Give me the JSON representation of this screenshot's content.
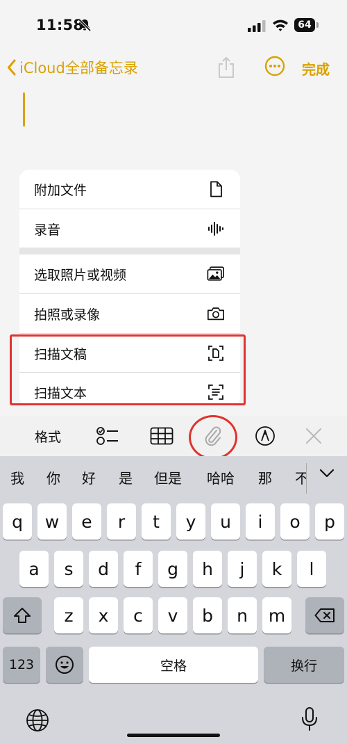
{
  "status_bar": {
    "time": "11:58",
    "battery": "64"
  },
  "nav": {
    "back_label": "iCloud全部备忘录",
    "done_label": "完成"
  },
  "menu": {
    "items": [
      {
        "label": "附加文件",
        "icon": "document-icon"
      },
      {
        "label": "录音",
        "icon": "waveform-icon"
      },
      {
        "label": "选取照片或视频",
        "icon": "photos-icon"
      },
      {
        "label": "拍照或录像",
        "icon": "camera-icon"
      },
      {
        "label": "扫描文稿",
        "icon": "scan-document-icon"
      },
      {
        "label": "扫描文本",
        "icon": "scan-text-icon"
      }
    ]
  },
  "toolbar": {
    "format_label": "格式",
    "icons": [
      "checklist-icon",
      "table-icon",
      "paperclip-icon",
      "markup-pen-icon",
      "close-icon"
    ]
  },
  "keyboard": {
    "candidates": [
      "我",
      "你",
      "好",
      "是",
      "但是",
      "哈哈",
      "那",
      "不"
    ],
    "row1": [
      "q",
      "w",
      "e",
      "r",
      "t",
      "y",
      "u",
      "i",
      "o",
      "p"
    ],
    "row2": [
      "a",
      "s",
      "d",
      "f",
      "g",
      "h",
      "j",
      "k",
      "l"
    ],
    "row3": [
      "z",
      "x",
      "c",
      "v",
      "b",
      "n",
      "m"
    ],
    "numbers_key": "123",
    "space_label": "空格",
    "return_label": "换行"
  },
  "colors": {
    "accent": "#d9a200",
    "highlight": "#e0322f"
  }
}
